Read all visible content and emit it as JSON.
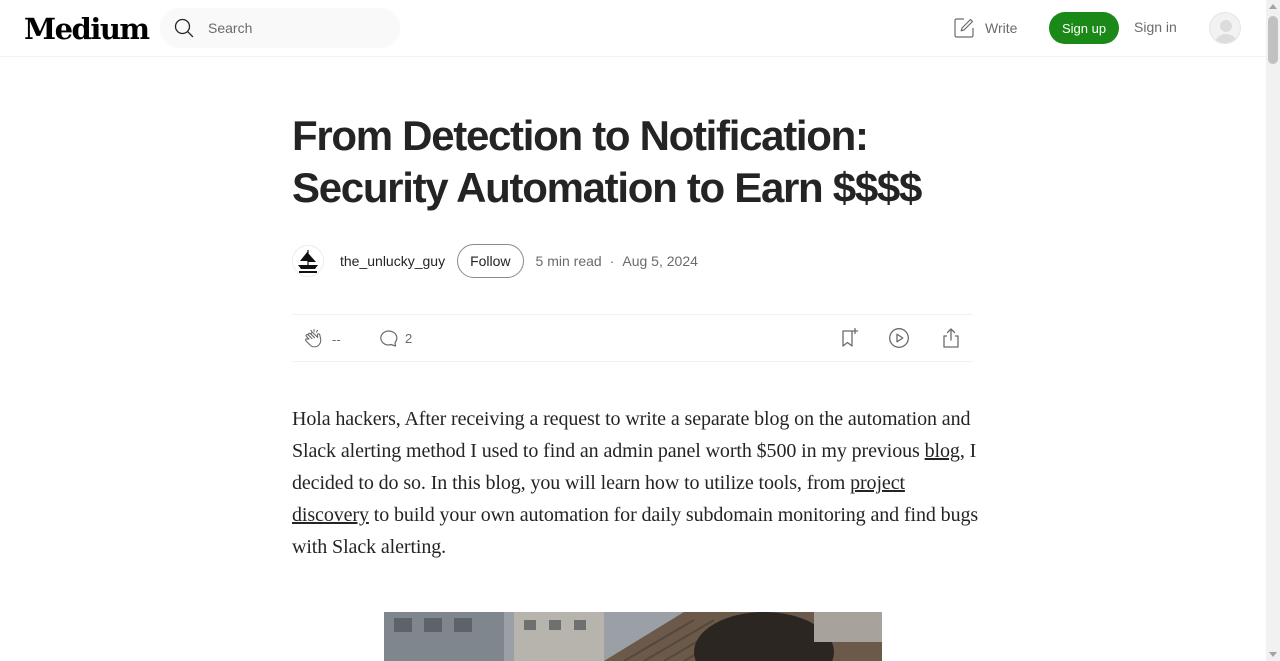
{
  "header": {
    "logo": "Medium",
    "search_placeholder": "Search",
    "write_label": "Write",
    "signup_label": "Sign up",
    "signin_label": "Sign in"
  },
  "article": {
    "title": "From Detection to Notification: Security Automation to Earn $$$$",
    "author": "the_unlucky_guy",
    "follow_label": "Follow",
    "read_time": "5 min read",
    "separator": "·",
    "date": "Aug 5, 2024",
    "claps": "--",
    "responses": "2",
    "paragraph": {
      "part1": "Hola hackers, After receiving a request to write a separate blog on the automation and Slack alerting method I used to find an admin panel worth $500 in my previous ",
      "link1": "blog",
      "part2": ", I decided to do so. In this blog, you will learn how to utilize tools, from ",
      "link2": "project discovery",
      "part3": " to build your own automation for daily subdomain monitoring and find bugs with Slack alerting."
    }
  },
  "colors": {
    "accent": "#1a8917",
    "text": "#242424",
    "muted": "#6b6b6b"
  },
  "icons": [
    "search-icon",
    "write-icon",
    "user-avatar-icon",
    "clap-icon",
    "comment-icon",
    "bookmark-icon",
    "play-icon",
    "share-icon"
  ]
}
